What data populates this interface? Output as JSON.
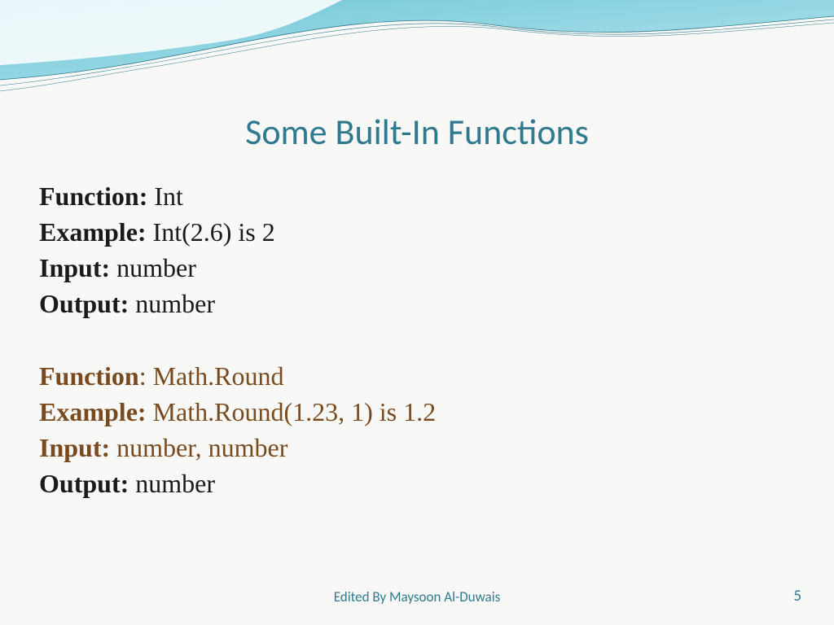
{
  "title": "Some Built-In Functions",
  "block1": {
    "function_label": "Function: ",
    "function_value": "Int",
    "example_label": "Example: ",
    "example_value": "Int(2.6) is 2",
    "input_label": "Input: ",
    "input_value": "number",
    "output_label": "Output: ",
    "output_value": "number"
  },
  "block2": {
    "function_label": "Function",
    "function_sep": ": ",
    "function_value": "Math.Round",
    "example_label": "Example: ",
    "example_value": "Math.Round(1.23, 1) is 1.2",
    "input_label": "Input: ",
    "input_value": "number, number",
    "output_label": "Output: ",
    "output_value": "number"
  },
  "footer": "Edited By Maysoon Al-Duwais",
  "page": "5"
}
